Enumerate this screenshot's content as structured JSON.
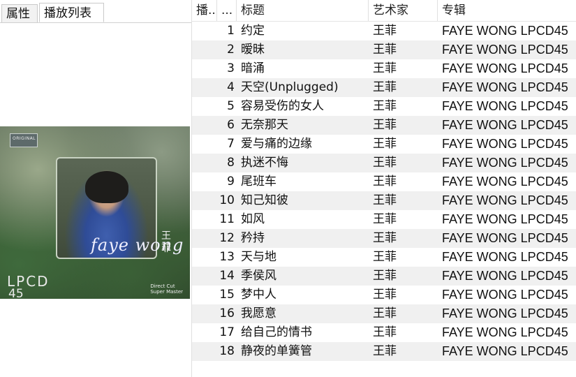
{
  "tabs": [
    {
      "label": "属性",
      "active": false
    },
    {
      "label": "播放列表",
      "active": true
    }
  ],
  "cover": {
    "logo_text": "ORIGINAL",
    "script_text": "faye wong",
    "cn_name": "王菲",
    "lpcd": "LPCD",
    "number": "45",
    "direct_cut": "Direct Cut",
    "super_master": "Super Master"
  },
  "columns": [
    "播...",
    "...",
    "标题",
    "艺术家",
    "专辑"
  ],
  "tracks": [
    {
      "n": "1",
      "title": "约定",
      "artist": "王菲",
      "album": "FAYE WONG  LPCD45"
    },
    {
      "n": "2",
      "title": "暧昧",
      "artist": "王菲",
      "album": "FAYE WONG  LPCD45"
    },
    {
      "n": "3",
      "title": "暗涌",
      "artist": "王菲",
      "album": "FAYE WONG  LPCD45"
    },
    {
      "n": "4",
      "title": "天空(Unplugged)",
      "artist": "王菲",
      "album": "FAYE WONG  LPCD45"
    },
    {
      "n": "5",
      "title": "容易受伤的女人",
      "artist": "王菲",
      "album": "FAYE WONG  LPCD45"
    },
    {
      "n": "6",
      "title": "无奈那天",
      "artist": "王菲",
      "album": "FAYE WONG  LPCD45"
    },
    {
      "n": "7",
      "title": "爱与痛的边缘",
      "artist": "王菲",
      "album": "FAYE WONG  LPCD45"
    },
    {
      "n": "8",
      "title": "执迷不悔",
      "artist": "王菲",
      "album": "FAYE WONG  LPCD45"
    },
    {
      "n": "9",
      "title": "尾班车",
      "artist": "王菲",
      "album": "FAYE WONG  LPCD45"
    },
    {
      "n": "10",
      "title": "知己知彼",
      "artist": "王菲",
      "album": "FAYE WONG  LPCD45"
    },
    {
      "n": "11",
      "title": "如风",
      "artist": "王菲",
      "album": "FAYE WONG  LPCD45"
    },
    {
      "n": "12",
      "title": "矜持",
      "artist": "王菲",
      "album": "FAYE WONG  LPCD45"
    },
    {
      "n": "13",
      "title": "天与地",
      "artist": "王菲",
      "album": "FAYE WONG  LPCD45"
    },
    {
      "n": "14",
      "title": "季侯风",
      "artist": "王菲",
      "album": "FAYE WONG  LPCD45"
    },
    {
      "n": "15",
      "title": "梦中人",
      "artist": "王菲",
      "album": "FAYE WONG  LPCD45"
    },
    {
      "n": "16",
      "title": "我愿意",
      "artist": "王菲",
      "album": "FAYE WONG  LPCD45"
    },
    {
      "n": "17",
      "title": "给自己的情书",
      "artist": "王菲",
      "album": "FAYE WONG  LPCD45"
    },
    {
      "n": "18",
      "title": "静夜的单簧管",
      "artist": "王菲",
      "album": "FAYE WONG  LPCD45"
    }
  ]
}
